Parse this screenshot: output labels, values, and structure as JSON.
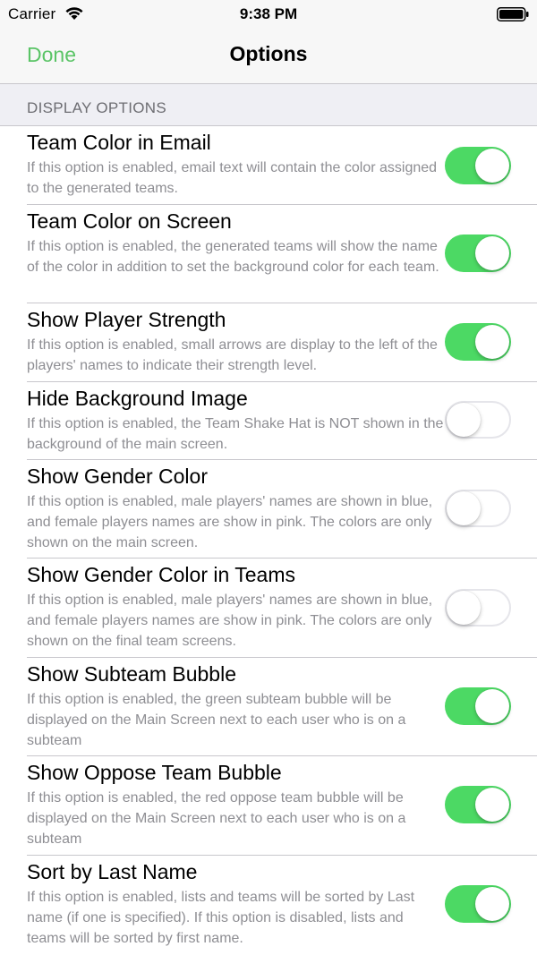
{
  "status_bar": {
    "carrier": "Carrier",
    "time": "9:38 PM",
    "wifi_icon": "wifi-icon",
    "battery_icon": "battery-icon"
  },
  "nav": {
    "done_label": "Done",
    "title": "Options",
    "done_color": "#5ac466"
  },
  "section": {
    "header": "DISPLAY OPTIONS"
  },
  "colors": {
    "toggle_on": "#4cd964",
    "description_text": "#8e8e93",
    "section_bg": "#efeff4"
  },
  "options": [
    {
      "title": "Team Color in Email",
      "description": "If this option is enabled, email text will contain the color assigned to the generated teams.",
      "enabled": true
    },
    {
      "title": "Team Color on Screen",
      "description": "If this option is enabled, the generated teams will show the name of the color in addition to set the background color for each team.",
      "enabled": true
    },
    {
      "title": "Show Player Strength",
      "description": "If this option is enabled, small arrows are display to the left of the players' names to indicate their strength level.",
      "enabled": true
    },
    {
      "title": "Hide Background Image",
      "description": "If this option is enabled, the Team Shake Hat is NOT shown in the background of the main screen.",
      "enabled": false
    },
    {
      "title": "Show Gender Color",
      "description": "If this option is enabled, male players' names are shown in blue, and female players names are show in pink.  The colors are only shown on the main screen.",
      "enabled": false
    },
    {
      "title": "Show Gender Color in Teams",
      "description": "If this option is enabled, male players' names are shown in blue, and female players names are show in pink.  The colors are only shown on the final team screens.",
      "enabled": false
    },
    {
      "title": "Show Subteam Bubble",
      "description": "If this option is enabled, the green subteam bubble will be displayed on the Main Screen next to each user who is on a subteam",
      "enabled": true
    },
    {
      "title": "Show Oppose Team Bubble",
      "description": "If this option is enabled, the red oppose team bubble will be displayed on the Main Screen next to each user who is on a subteam",
      "enabled": true
    },
    {
      "title": "Sort by Last Name",
      "description": "If this option is enabled, lists and teams will be sorted by Last name (if one is specified).  If this option is disabled, lists and teams will be sorted by first name.",
      "enabled": true
    }
  ]
}
